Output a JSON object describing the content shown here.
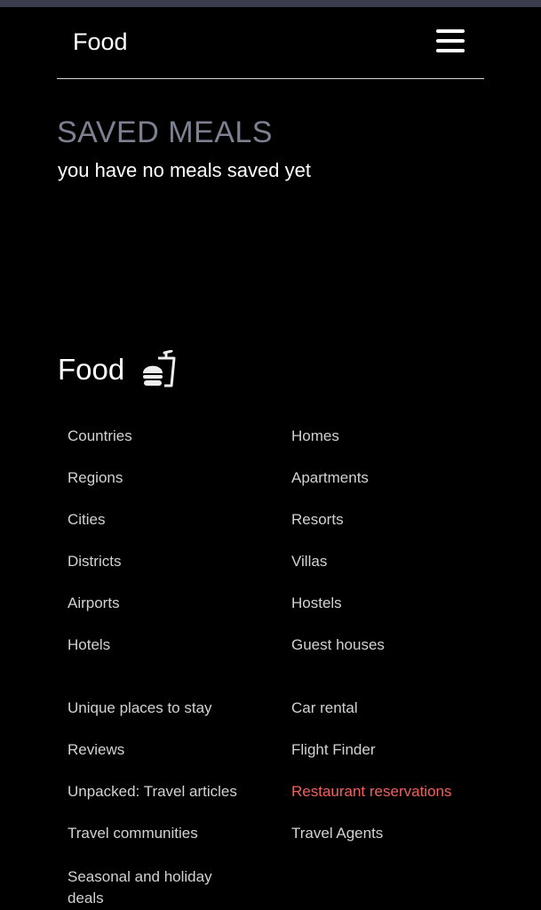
{
  "header": {
    "brand": "Food",
    "menu_icon": "hamburger-menu-icon"
  },
  "saved": {
    "title": "SAVED MEALS",
    "message": "you have no meals saved yet"
  },
  "footer": {
    "brand": "Food",
    "icon": "fast-food-icon",
    "highlight_color": "#f0605d",
    "group1_left": [
      "Countries",
      "Regions",
      "Cities",
      "Districts",
      "Airports",
      "Hotels"
    ],
    "group1_right": [
      "Homes",
      "Apartments",
      "Resorts",
      "Villas",
      "Hostels",
      "Guest houses"
    ],
    "group2_left": [
      "Unique places to stay",
      "Reviews",
      "Unpacked: Travel articles",
      "Travel communities",
      "Seasonal and holiday deals"
    ],
    "group2_right": [
      "Car rental",
      "Flight Finder",
      "Restaurant reservations",
      "Travel Agents"
    ]
  }
}
